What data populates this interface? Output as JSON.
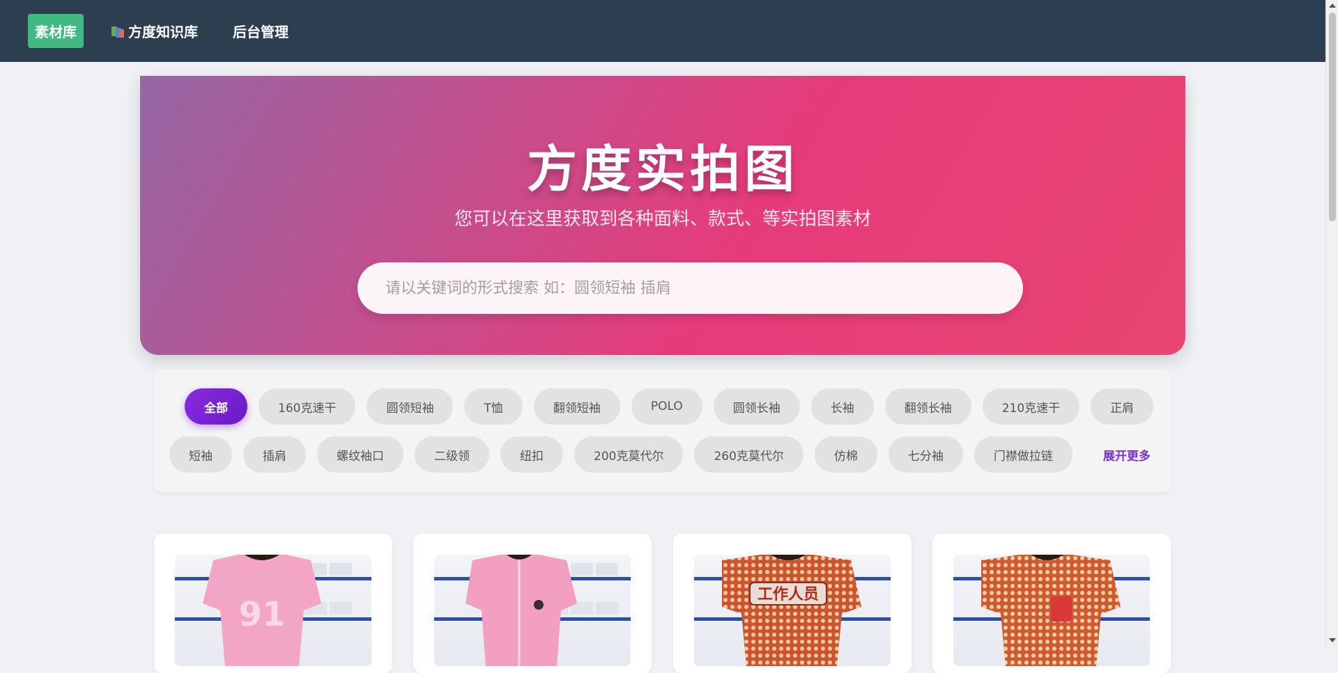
{
  "nav": {
    "items": [
      {
        "label": "素材库",
        "active": true
      },
      {
        "label": "方度知识库",
        "icon": "books-icon"
      },
      {
        "label": "后台管理"
      }
    ]
  },
  "hero": {
    "title": "方度实拍图",
    "subtitle": "您可以在这里获取到各种面料、款式、等实拍图素材",
    "search_placeholder": "请以关键词的形式搜索 如：圆领短袖 插肩"
  },
  "tags": {
    "row1": [
      "全部",
      "160克速干",
      "圆领短袖",
      "T恤",
      "翻领短袖",
      "POLO",
      "圆领长袖",
      "长袖",
      "翻领长袖",
      "210克速干",
      "正肩"
    ],
    "row2": [
      "短袖",
      "插肩",
      "螺纹袖口",
      "二级领",
      "纽扣",
      "200克莫代尔",
      "260克莫代尔",
      "仿棉",
      "七分袖",
      "门襟做拉链"
    ],
    "active": "全部",
    "expand_label": "展开更多"
  },
  "colors": {
    "nav_bg": "#2c3e50",
    "nav_active": "#42b883",
    "tag_active": "#8a2be2",
    "expand": "#7b2fd6"
  },
  "cards": [
    {
      "name": "pink-jersey-back-photo",
      "print": "91"
    },
    {
      "name": "pink-jersey-front-photo"
    },
    {
      "name": "pattern-shirt-back-photo",
      "print": "工作人员"
    },
    {
      "name": "pattern-shirt-front-photo"
    }
  ]
}
